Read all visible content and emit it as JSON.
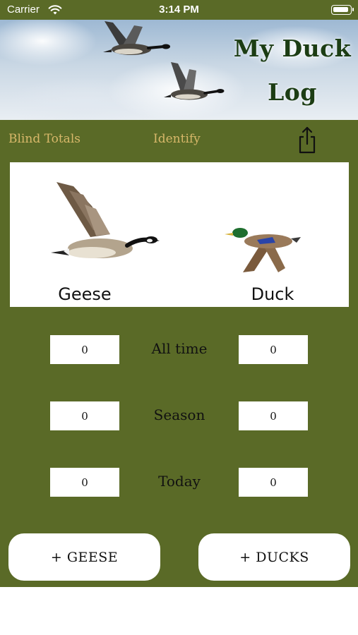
{
  "status_bar": {
    "carrier": "Carrier",
    "time": "3:14 PM"
  },
  "header": {
    "title_line1": "My Duck",
    "title_line2": "Log"
  },
  "nav": {
    "blind_totals": "Blind Totals",
    "identify": "Identify"
  },
  "panel": {
    "geese_label": "Geese",
    "duck_label": "Duck"
  },
  "counts": {
    "rows": [
      {
        "label": "All time",
        "geese": "0",
        "ducks": "0"
      },
      {
        "label": "Season",
        "geese": "0",
        "ducks": "0"
      },
      {
        "label": "Today",
        "geese": "0",
        "ducks": "0"
      }
    ]
  },
  "buttons": {
    "add_geese": "+ GEESE",
    "add_ducks": "+ DUCKS"
  },
  "colors": {
    "background": "#5a6a27",
    "nav_text": "#d8b86a",
    "title": "#1c3d14"
  }
}
